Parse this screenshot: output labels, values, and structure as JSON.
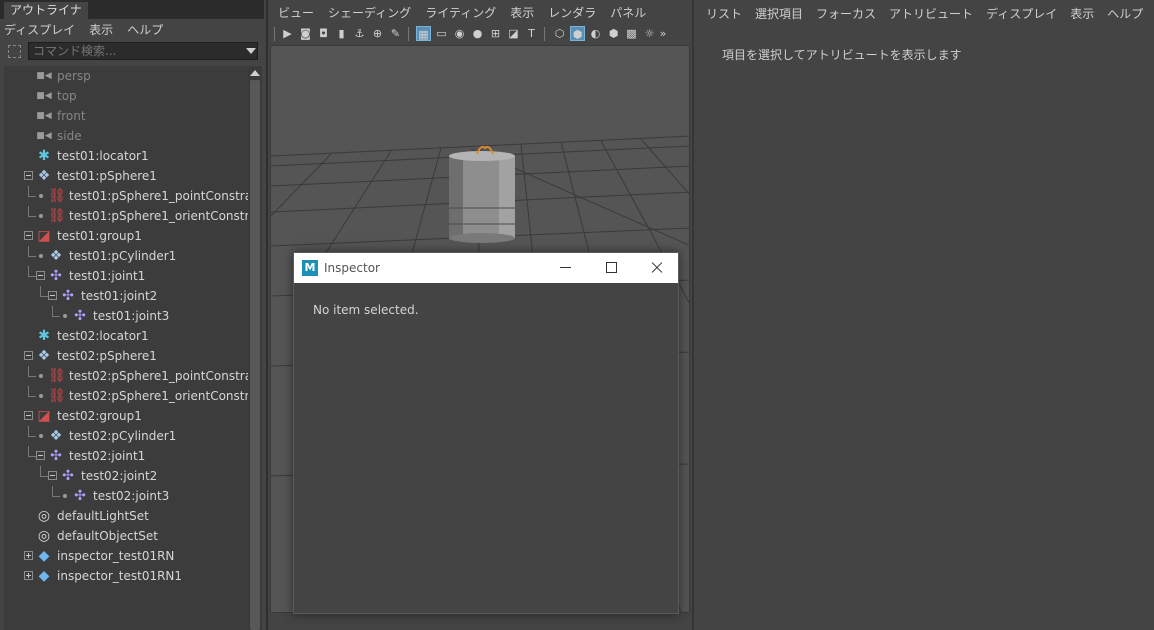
{
  "outliner": {
    "tab": "アウトライナ",
    "menu": [
      "ディスプレイ",
      "表示",
      "ヘルプ"
    ],
    "search_placeholder": "コマンド検索...",
    "items": [
      {
        "label": "persp",
        "icon": "camera-icon",
        "level": 0,
        "expander": "none",
        "dim": true
      },
      {
        "label": "top",
        "icon": "camera-icon",
        "level": 0,
        "expander": "none",
        "dim": true
      },
      {
        "label": "front",
        "icon": "camera-icon",
        "level": 0,
        "expander": "none",
        "dim": true
      },
      {
        "label": "side",
        "icon": "camera-icon",
        "level": 0,
        "expander": "none",
        "dim": true
      },
      {
        "label": "test01:locator1",
        "icon": "locator-icon",
        "level": 0,
        "expander": "none",
        "dim": false
      },
      {
        "label": "test01:pSphere1",
        "icon": "transform-icon",
        "level": 0,
        "expander": "minus",
        "dim": false
      },
      {
        "label": "test01:pSphere1_pointConstra",
        "icon": "constraint-icon",
        "level": 1,
        "expander": "leaf",
        "dim": false
      },
      {
        "label": "test01:pSphere1_orientConstra",
        "icon": "constraint-icon",
        "level": 1,
        "expander": "leaf",
        "dim": false
      },
      {
        "label": "test01:group1",
        "icon": "group-icon",
        "level": 0,
        "expander": "minus",
        "dim": false
      },
      {
        "label": "test01:pCylinder1",
        "icon": "transform-icon",
        "level": 1,
        "expander": "leaf",
        "dim": false
      },
      {
        "label": "test01:joint1",
        "icon": "joint-icon",
        "level": 1,
        "expander": "minus",
        "dim": false
      },
      {
        "label": "test01:joint2",
        "icon": "joint-icon",
        "level": 2,
        "expander": "minus",
        "dim": false
      },
      {
        "label": "test01:joint3",
        "icon": "joint-icon",
        "level": 3,
        "expander": "leaf",
        "dim": false
      },
      {
        "label": "test02:locator1",
        "icon": "locator-icon",
        "level": 0,
        "expander": "none",
        "dim": false
      },
      {
        "label": "test02:pSphere1",
        "icon": "transform-icon",
        "level": 0,
        "expander": "minus",
        "dim": false
      },
      {
        "label": "test02:pSphere1_pointConstra",
        "icon": "constraint-icon",
        "level": 1,
        "expander": "leaf",
        "dim": false
      },
      {
        "label": "test02:pSphere1_orientConstra",
        "icon": "constraint-icon",
        "level": 1,
        "expander": "leaf",
        "dim": false
      },
      {
        "label": "test02:group1",
        "icon": "group-icon",
        "level": 0,
        "expander": "minus",
        "dim": false
      },
      {
        "label": "test02:pCylinder1",
        "icon": "transform-icon",
        "level": 1,
        "expander": "leaf",
        "dim": false
      },
      {
        "label": "test02:joint1",
        "icon": "joint-icon",
        "level": 1,
        "expander": "minus",
        "dim": false
      },
      {
        "label": "test02:joint2",
        "icon": "joint-icon",
        "level": 2,
        "expander": "minus",
        "dim": false
      },
      {
        "label": "test02:joint3",
        "icon": "joint-icon",
        "level": 3,
        "expander": "leaf",
        "dim": false
      },
      {
        "label": "defaultLightSet",
        "icon": "set-icon",
        "level": 0,
        "expander": "none",
        "dim": false
      },
      {
        "label": "defaultObjectSet",
        "icon": "set-icon",
        "level": 0,
        "expander": "none",
        "dim": false
      },
      {
        "label": "inspector_test01RN",
        "icon": "reference-icon",
        "level": 0,
        "expander": "plus",
        "dim": false
      },
      {
        "label": "inspector_test01RN1",
        "icon": "reference-icon",
        "level": 0,
        "expander": "plus",
        "dim": false
      }
    ]
  },
  "viewport": {
    "menu": [
      "ビュー",
      "シェーディング",
      "ライティング",
      "表示",
      "レンダラ",
      "パネル"
    ]
  },
  "attribute_editor": {
    "menu": [
      "リスト",
      "選択項目",
      "フォーカス",
      "アトリビュート",
      "ディスプレイ",
      "表示",
      "ヘルプ"
    ],
    "message": "項目を選択してアトリビュートを表示します"
  },
  "inspector": {
    "logo": "M",
    "title": "Inspector",
    "message": "No item selected."
  },
  "colors": {
    "panel_bg": "#444444",
    "tree_bg": "#3c3c3c",
    "active_tool": "#5a8fb5",
    "viewport_bg": "#555555"
  }
}
